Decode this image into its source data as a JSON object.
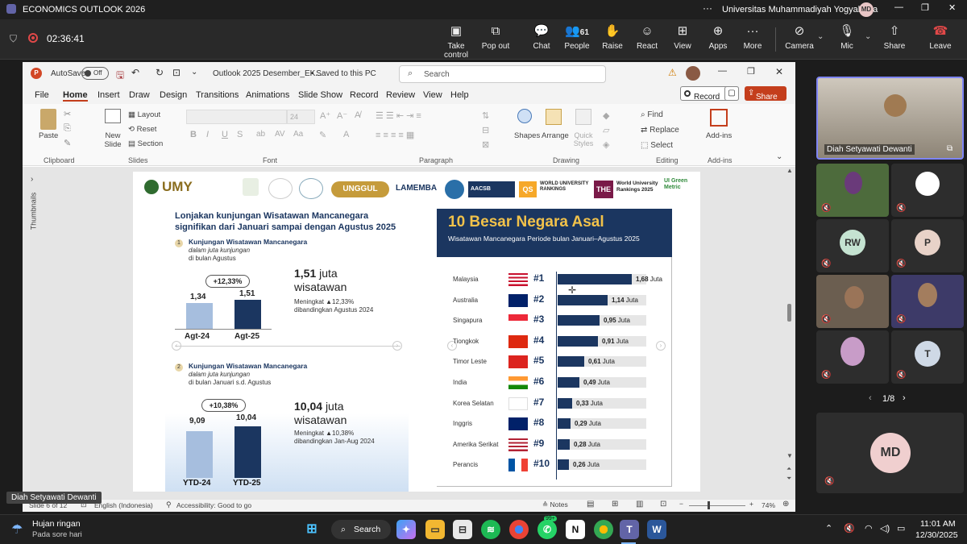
{
  "teams": {
    "window_title": "ECONOMICS OUTLOOK 2026",
    "org_name": "Universitas Muhammadiyah Yogyakarta",
    "user_initials": "MD",
    "timer": "02:36:41",
    "toolbar": [
      {
        "label": "Take control"
      },
      {
        "label": "Pop out"
      },
      {
        "label": "Chat"
      },
      {
        "label": "People",
        "count": "61"
      },
      {
        "label": "Raise"
      },
      {
        "label": "React"
      },
      {
        "label": "View"
      },
      {
        "label": "Apps"
      },
      {
        "label": "More"
      },
      {
        "label": "Camera"
      },
      {
        "label": "Mic"
      },
      {
        "label": "Share"
      },
      {
        "label": "Leave"
      }
    ]
  },
  "ppt": {
    "autosave": "AutoSave",
    "autosave_state": "Off",
    "filename": "Outlook 2025 Desember_EK...",
    "save_state": "• Saved to this PC",
    "search_placeholder": "Search",
    "menu": [
      "File",
      "Home",
      "Insert",
      "Draw",
      "Design",
      "Transitions",
      "Animations",
      "Slide Show",
      "Record",
      "Review",
      "View",
      "Help"
    ],
    "record_btn": "Record",
    "share_btn": "Share",
    "ribbon": {
      "paste": "Paste",
      "new_slide": "New Slide",
      "layout": "Layout",
      "reset": "Reset",
      "section": "Section",
      "font_size": "24",
      "shapes": "Shapes",
      "arrange": "Arrange",
      "quick_styles": "Quick Styles",
      "find": "Find",
      "replace": "Replace",
      "select": "Select",
      "addins": "Add-ins",
      "groups": [
        "Clipboard",
        "Slides",
        "Font",
        "Paragraph",
        "Drawing",
        "Editing",
        "Add-ins"
      ]
    },
    "thumbnails_label": "Thumbnails",
    "status": {
      "slide": "Slide 6 of 12",
      "language": "English (Indonesia)",
      "accessibility": "Accessibility: Good to go",
      "notes": "Notes",
      "zoom": "74%"
    }
  },
  "slide": {
    "logos": [
      "UMY",
      "UNGGUL",
      "LAMEMBA",
      "AACSB",
      "QS",
      "WORLD UNIVERSITY RANKINGS",
      "THE",
      "World University Rankings 2025",
      "UI Green Metric"
    ],
    "left_title": "Lonjakan kunjungan Wisatawan Mancanegara signifikan dari Januari sampai dengan Agustus 2025",
    "section1": {
      "num": "1",
      "title": "Kunjungan Wisatawan Mancanegara",
      "sub": "dalam juta kunjungan",
      "sub2": "di bulan Agustus",
      "growth": "+12,33%",
      "bars": [
        {
          "label": "Agt-24",
          "value": 1.34,
          "text": "1,34"
        },
        {
          "label": "Agt-25",
          "value": 1.51,
          "text": "1,51"
        }
      ],
      "big_value": "1,51",
      "big_unit": "juta",
      "big_word": "wisatawan",
      "note1": "Meningkat ▲12,33%",
      "note2": "dibandingkan Agustus 2024"
    },
    "section2": {
      "num": "2",
      "title": "Kunjungan Wisatawan Mancanegara",
      "sub": "dalam juta kunjungan",
      "sub2": "di bulan Januari s.d. Agustus",
      "growth": "+10,38%",
      "bars": [
        {
          "label": "YTD-24",
          "value": 9.09,
          "text": "9,09"
        },
        {
          "label": "YTD-25",
          "value": 10.04,
          "text": "10,04"
        }
      ],
      "big_value": "10,04",
      "big_unit": "juta",
      "big_word": "wisatawan",
      "note1": "Meningkat ▲10,38%",
      "note2": "dibandingkan Jan-Aug 2024"
    },
    "right_title": "10 Besar Negara Asal",
    "right_subtitle": "Wisatawan Mancanegara Periode bulan Januari–Agustus 2025"
  },
  "chart_data": {
    "type": "bar",
    "title": "10 Besar Negara Asal",
    "unit": "Juta",
    "categories": [
      "Malaysia",
      "Australia",
      "Singapura",
      "Tiongkok",
      "Timor Leste",
      "India",
      "Korea Selatan",
      "Inggris",
      "Amerika Serikat",
      "Perancis"
    ],
    "ranks": [
      "#1",
      "#2",
      "#3",
      "#4",
      "#5",
      "#6",
      "#7",
      "#8",
      "#9",
      "#10"
    ],
    "values": [
      1.68,
      1.14,
      0.95,
      0.91,
      0.61,
      0.49,
      0.33,
      0.29,
      0.28,
      0.26
    ],
    "value_labels": [
      "1,68",
      "1,14",
      "0,95",
      "0,91",
      "0,61",
      "0,49",
      "0,33",
      "0,29",
      "0,28",
      "0,26"
    ],
    "xlim": [
      0,
      1.68
    ]
  },
  "participants": {
    "featured": "Diah Setyawati Dewanti",
    "tiles": [
      {
        "initials": "RW",
        "color": "#c5e3d1"
      },
      {
        "initials": "P",
        "color": "#e8d2c8"
      },
      {
        "initials": "T",
        "color": "#cfd9e6"
      }
    ],
    "page": "1/8",
    "self_initials": "MD",
    "self_color": "#f0cfcf",
    "caption": "Diah Setyawati Dewanti"
  },
  "taskbar": {
    "weather": "Hujan ringan",
    "weather_sub": "Pada sore hari",
    "search": "Search",
    "badge": "99+",
    "time": "11:01 AM",
    "date": "12/30/2025"
  }
}
